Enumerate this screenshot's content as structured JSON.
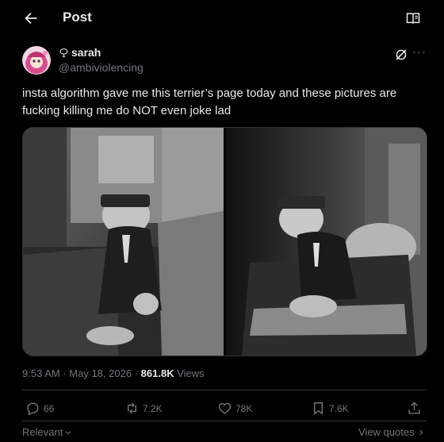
{
  "header": {
    "title": "Post",
    "back_icon": "arrow-left-icon",
    "reader_icon": "reader-mode-icon"
  },
  "author": {
    "name": "sarah",
    "handle": "@ambiviolencing",
    "name_prefix_icon": "grok-glyph-icon",
    "avatar": "anime-character-avatar"
  },
  "post": {
    "text": "insta algorithm gave me this terrier’s page today and these pictures are fucking killing me do NOT even joke lad",
    "time": "9:53 AM",
    "date": "May 18, 2026",
    "views_count": "861.8K",
    "views_label": "Views",
    "sep": "·"
  },
  "media": [
    {
      "icon": "photo",
      "desc_icon": "black-and-white-photo"
    },
    {
      "icon": "photo",
      "desc_icon": "black-and-white-photo"
    }
  ],
  "actions": {
    "reply": {
      "icon": "reply-icon",
      "count": "66"
    },
    "repost": {
      "icon": "repost-icon",
      "count": "7.2K"
    },
    "like": {
      "icon": "heart-icon",
      "count": "78K"
    },
    "bookmark": {
      "icon": "bookmark-icon",
      "count": "7.6K"
    },
    "share": {
      "icon": "share-icon"
    }
  },
  "footer": {
    "sort_label": "Relevant",
    "view_quotes_label": "View quotes"
  },
  "colors": {
    "bg": "#000000",
    "text": "#e7e9ea",
    "muted": "#71767b",
    "border": "#2f3336"
  }
}
